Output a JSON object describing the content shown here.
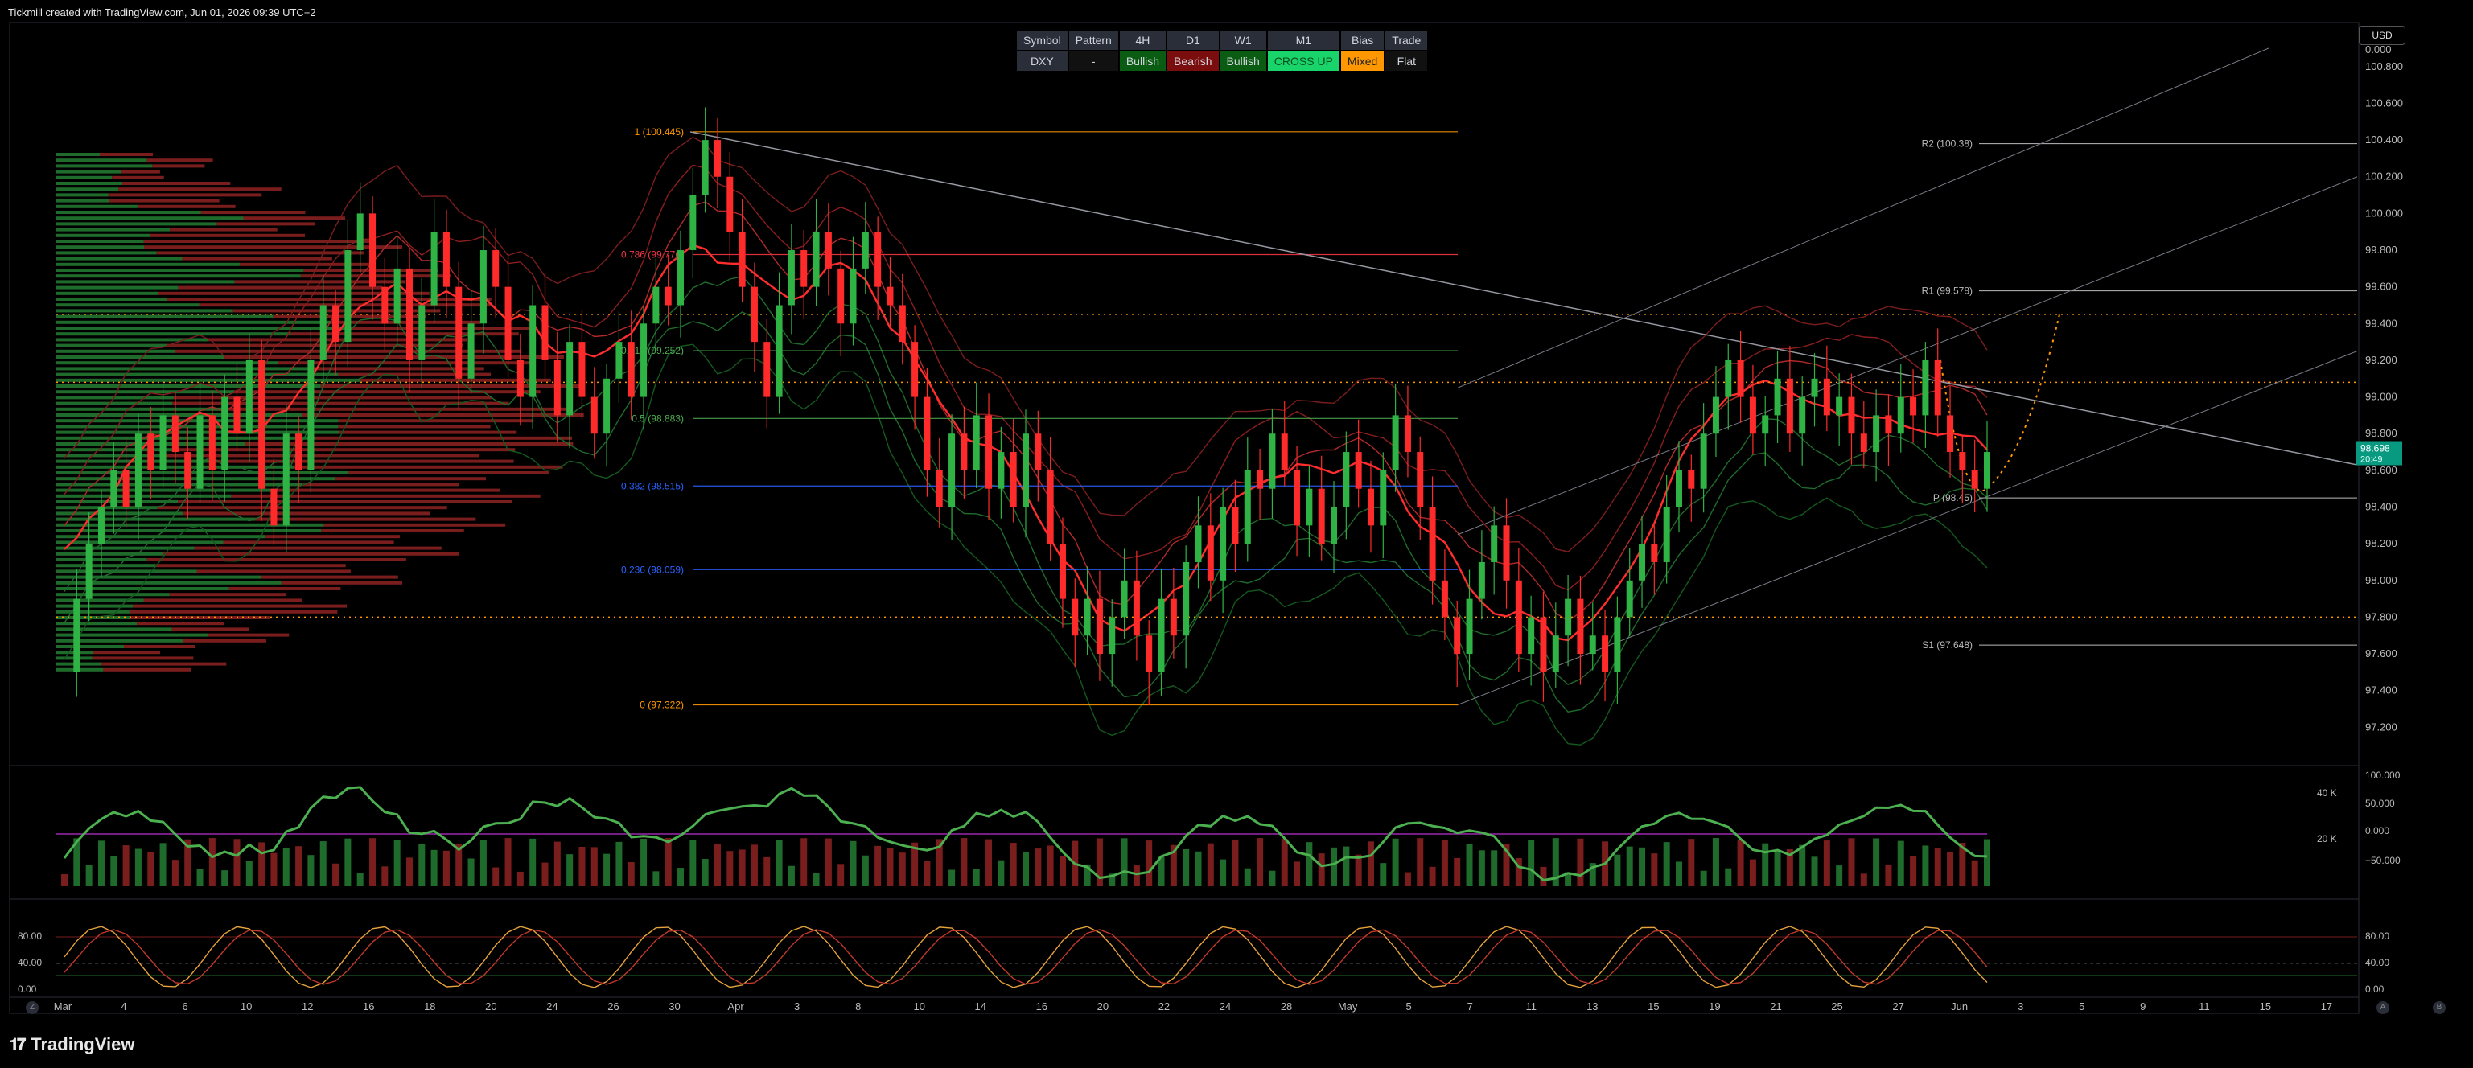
{
  "header": {
    "credit": "Tickmill created with TradingView.com, Jun 01, 2026 09:39 UTC+2"
  },
  "currency_button": "USD",
  "status_table": {
    "headers": [
      "Symbol",
      "Pattern",
      "4H",
      "D1",
      "W1",
      "M1",
      "Bias",
      "Trade"
    ],
    "values": [
      "DXY",
      "-",
      "Bullish",
      "Bearish",
      "Bullish",
      "CROSS UP",
      "Mixed",
      "Flat"
    ],
    "colors": [
      "#2a2e39",
      "#111111",
      "#0a5c12",
      "#7a0d0d",
      "#0a5c12",
      "#19d46a",
      "#ff9800",
      "#111111"
    ],
    "text_colors": [
      "#d1d4dc",
      "#d1d4dc",
      "#d1d4dc",
      "#d1d4dc",
      "#d1d4dc",
      "#0a4f1f",
      "#222222",
      "#d1d4dc"
    ]
  },
  "footer": {
    "logo": "TradingView",
    "left_badge": "Z",
    "right_badges": [
      "A",
      "B"
    ]
  },
  "chart_data": {
    "type": "candlestick",
    "price_axis": {
      "ticks": [
        "100.800",
        "100.600",
        "100.400",
        "100.200",
        "100.000",
        "99.800",
        "99.600",
        "99.400",
        "99.200",
        "99.000",
        "98.800",
        "98.600",
        "98.400",
        "98.200",
        "98.000",
        "97.800",
        "97.600",
        "97.400",
        "97.200"
      ],
      "top_label": "0.000",
      "ylim": [
        97.0,
        100.9
      ],
      "last_price": "98.698",
      "last_sub": "20:49"
    },
    "x_axis": {
      "labels": [
        "Mar",
        "4",
        "6",
        "10",
        "12",
        "16",
        "18",
        "20",
        "24",
        "26",
        "30",
        "Apr",
        "3",
        "8",
        "10",
        "14",
        "16",
        "20",
        "22",
        "24",
        "28",
        "May",
        "5",
        "7",
        "11",
        "13",
        "15",
        "19",
        "21",
        "25",
        "27",
        "Jun",
        "3",
        "5",
        "9",
        "11",
        "15",
        "17"
      ]
    },
    "fibonacci": [
      {
        "label": "1 (100.445)",
        "value": 100.445,
        "color": "#ff9800"
      },
      {
        "label": "0.786 (99.776)",
        "value": 99.776,
        "color": "#f23645"
      },
      {
        "label": "0.618 (99.252)",
        "value": 99.252,
        "color": "#4caf50"
      },
      {
        "label": "0.5 (98.883)",
        "value": 98.883,
        "color": "#4caf50"
      },
      {
        "label": "0.382 (98.515)",
        "value": 98.515,
        "color": "#2962ff"
      },
      {
        "label": "0.236 (98.059)",
        "value": 98.059,
        "color": "#2962ff"
      },
      {
        "label": "0 (97.322)",
        "value": 97.322,
        "color": "#ff9800"
      }
    ],
    "pivots": [
      {
        "label": "R2 (100.38)",
        "value": 100.38
      },
      {
        "label": "R1 (99.578)",
        "value": 99.578
      },
      {
        "label": "P (98.45)",
        "value": 98.45
      },
      {
        "label": "S1 (97.648)",
        "value": 97.648
      }
    ],
    "dotted_levels": [
      99.45,
      99.08,
      97.8
    ],
    "close_series": [
      97.5,
      97.9,
      98.2,
      98.4,
      98.6,
      98.4,
      98.8,
      98.6,
      98.9,
      98.7,
      98.5,
      98.9,
      98.6,
      99.0,
      98.8,
      99.2,
      98.5,
      98.3,
      98.8,
      98.6,
      99.2,
      99.5,
      99.3,
      99.8,
      100.0,
      99.6,
      99.4,
      99.7,
      99.2,
      99.5,
      99.9,
      99.6,
      99.1,
      99.4,
      99.8,
      99.6,
      99.2,
      99.0,
      99.5,
      99.2,
      98.9,
      99.3,
      99.0,
      98.8,
      99.1,
      99.3,
      99.0,
      99.4,
      99.6,
      99.5,
      99.8,
      100.1,
      100.4,
      100.2,
      99.9,
      99.6,
      99.3,
      99.0,
      99.5,
      99.8,
      99.6,
      99.9,
      99.7,
      99.4,
      99.7,
      99.9,
      99.6,
      99.5,
      99.3,
      99.0,
      98.6,
      98.4,
      98.8,
      98.6,
      98.9,
      98.5,
      98.7,
      98.4,
      98.8,
      98.6,
      98.2,
      97.9,
      97.7,
      97.9,
      97.6,
      97.8,
      98.0,
      97.7,
      97.5,
      97.9,
      97.7,
      98.1,
      98.3,
      98.0,
      98.4,
      98.2,
      98.6,
      98.5,
      98.8,
      98.6,
      98.3,
      98.5,
      98.2,
      98.4,
      98.7,
      98.5,
      98.3,
      98.6,
      98.9,
      98.7,
      98.4,
      98.0,
      97.8,
      97.6,
      97.9,
      98.1,
      98.3,
      98.0,
      97.6,
      97.8,
      97.5,
      97.7,
      97.9,
      97.6,
      97.7,
      97.5,
      97.8,
      98.0,
      98.2,
      98.1,
      98.4,
      98.6,
      98.5,
      98.8,
      99.0,
      99.2,
      99.0,
      98.8,
      98.9,
      99.1,
      98.8,
      99.0,
      99.1,
      98.9,
      99.0,
      98.8,
      98.7,
      98.9,
      98.8,
      99.0,
      98.9,
      99.2,
      98.9,
      98.7,
      98.6,
      98.5,
      98.7
    ],
    "volume_axis": [
      "40 K",
      "20 K"
    ],
    "oscillator_axis": [
      "100.000",
      "50.000",
      "0.000",
      "−50.000"
    ],
    "stoch_axis": [
      "80.00",
      "40.00",
      "0.00"
    ]
  }
}
